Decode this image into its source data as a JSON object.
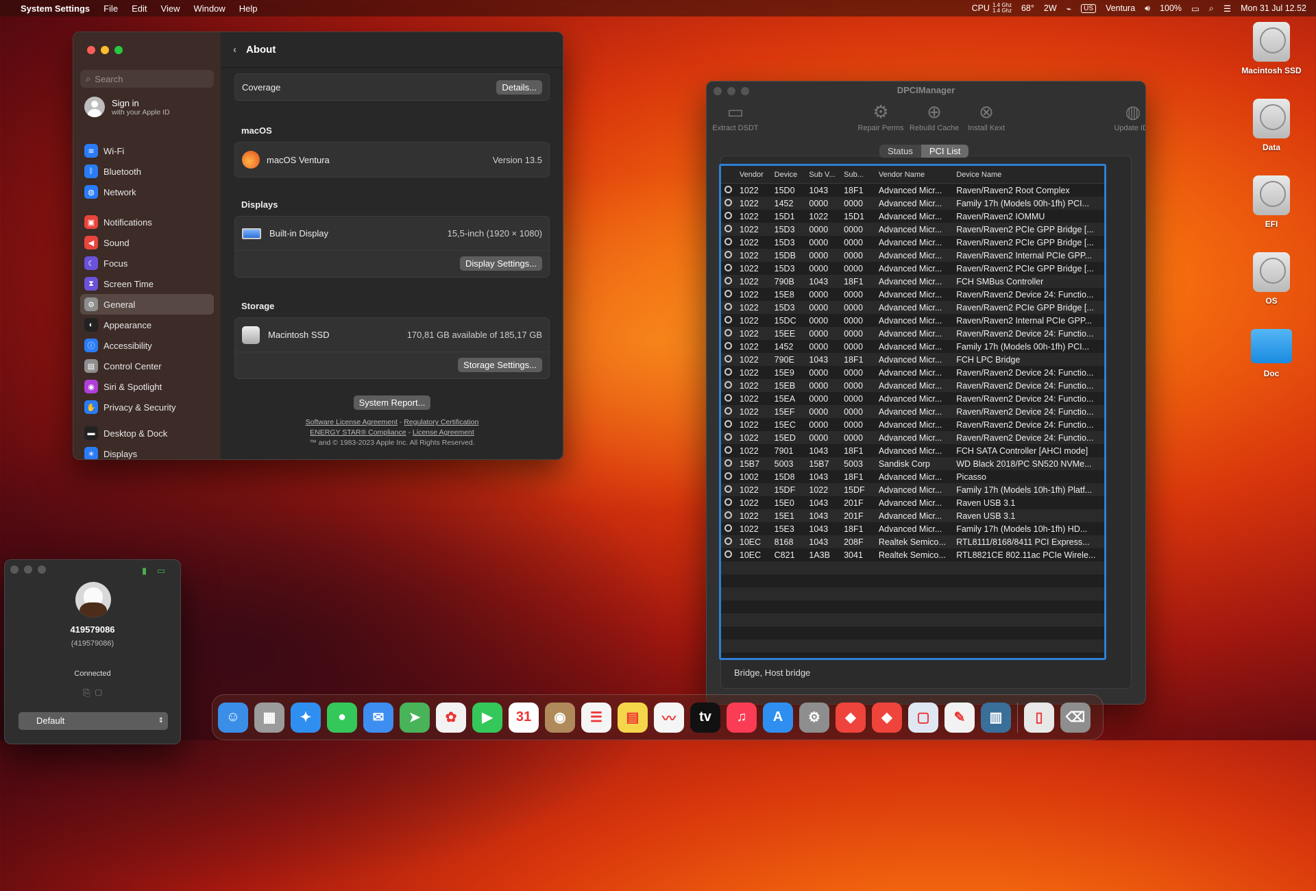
{
  "menubar": {
    "app": "System Settings",
    "menus": [
      "File",
      "Edit",
      "View",
      "Window",
      "Help"
    ],
    "cpu_label": "CPU",
    "cpu_f1": "1.4 Ghz",
    "cpu_f2": "1.4 Ghz",
    "temp": "68°",
    "power": "2W",
    "lang": "US",
    "os_name": "Ventura",
    "battery": "100%",
    "datetime": "Mon 31 Jul  12.52"
  },
  "settings": {
    "search_placeholder": "Search",
    "signin_title": "Sign in",
    "signin_sub": "with your Apple ID",
    "groups": [
      [
        {
          "label": "Wi-Fi",
          "icon": "wifi-icon",
          "color": "#2a7cf6",
          "glyph": "≋"
        },
        {
          "label": "Bluetooth",
          "icon": "bluetooth-icon",
          "color": "#2a7cf6",
          "glyph": "ᛒ"
        },
        {
          "label": "Network",
          "icon": "network-icon",
          "color": "#2a7cf6",
          "glyph": "◍"
        }
      ],
      [
        {
          "label": "Notifications",
          "icon": "notifications-icon",
          "color": "#e8453c",
          "glyph": "▣"
        },
        {
          "label": "Sound",
          "icon": "sound-icon",
          "color": "#e8453c",
          "glyph": "◀"
        },
        {
          "label": "Focus",
          "icon": "focus-icon",
          "color": "#6a52d9",
          "glyph": "☾"
        },
        {
          "label": "Screen Time",
          "icon": "screen-time-icon",
          "color": "#6a52d9",
          "glyph": "⧗"
        }
      ],
      [
        {
          "label": "General",
          "icon": "general-icon",
          "color": "#8e8e8e",
          "glyph": "⚙"
        },
        {
          "label": "Appearance",
          "icon": "appearance-icon",
          "color": "#222",
          "glyph": "◐"
        },
        {
          "label": "Accessibility",
          "icon": "accessibility-icon",
          "color": "#2a7cf6",
          "glyph": "ⓘ"
        },
        {
          "label": "Control Center",
          "icon": "control-center-icon",
          "color": "#8e8e8e",
          "glyph": "▤"
        },
        {
          "label": "Siri & Spotlight",
          "icon": "siri-icon",
          "color": "#b03fd9",
          "glyph": "◉"
        },
        {
          "label": "Privacy & Security",
          "icon": "privacy-icon",
          "color": "#2a7cf6",
          "glyph": "✋"
        }
      ],
      [
        {
          "label": "Desktop & Dock",
          "icon": "desktop-dock-icon",
          "color": "#222",
          "glyph": "▬"
        },
        {
          "label": "Displays",
          "icon": "displays-icon",
          "color": "#2a7cf6",
          "glyph": "☀"
        }
      ]
    ],
    "selected": "General",
    "page_title": "About",
    "coverage_label": "Coverage",
    "details_btn": "Details...",
    "macos_head": "macOS",
    "macos_name": "macOS Ventura",
    "macos_version": "Version 13.5",
    "displays_head": "Displays",
    "display_name": "Built-in Display",
    "display_val": "15,5-inch (1920 × 1080)",
    "display_btn": "Display Settings...",
    "storage_head": "Storage",
    "storage_name": "Macintosh SSD",
    "storage_val": "170,81 GB available of 185,17 GB",
    "storage_btn": "Storage Settings...",
    "report_btn": "System Report...",
    "link1": "Software License Agreement",
    "link2": "Regulatory Certification",
    "link3": "ENERGY STAR® Compliance",
    "link4": "License Agreement",
    "sep": "-",
    "copyright": "™ and © 1983-2023 Apple Inc. All Rights Reserved."
  },
  "dpci": {
    "title": "DPCIManager",
    "tools": [
      {
        "label": "Extract DSDT",
        "icon": "extract-dsdt-icon",
        "glyph": "▭"
      },
      {
        "label": "Repair Perms",
        "icon": "repair-perms-icon",
        "glyph": "⚙"
      },
      {
        "label": "Rebuild Cache",
        "icon": "rebuild-cache-icon",
        "glyph": "⊕"
      },
      {
        "label": "Install Kext",
        "icon": "install-kext-icon",
        "glyph": "⊗"
      },
      {
        "label": "Update IDs",
        "icon": "update-ids-icon",
        "glyph": "◍"
      }
    ],
    "tabs": [
      "Status",
      "PCI List"
    ],
    "active_tab": "PCI List",
    "columns": [
      "Vendor",
      "Device",
      "Sub V...",
      "Sub...",
      "Vendor Name",
      "Device Name"
    ],
    "rows": [
      [
        "1022",
        "15D0",
        "1043",
        "18F1",
        "Advanced Micr...",
        "Raven/Raven2 Root Complex"
      ],
      [
        "1022",
        "1452",
        "0000",
        "0000",
        "Advanced Micr...",
        "Family 17h (Models 00h-1fh) PCI..."
      ],
      [
        "1022",
        "15D1",
        "1022",
        "15D1",
        "Advanced Micr...",
        "Raven/Raven2 IOMMU"
      ],
      [
        "1022",
        "15D3",
        "0000",
        "0000",
        "Advanced Micr...",
        "Raven/Raven2 PCIe GPP Bridge [..."
      ],
      [
        "1022",
        "15D3",
        "0000",
        "0000",
        "Advanced Micr...",
        "Raven/Raven2 PCIe GPP Bridge [..."
      ],
      [
        "1022",
        "15DB",
        "0000",
        "0000",
        "Advanced Micr...",
        "Raven/Raven2 Internal PCIe GPP..."
      ],
      [
        "1022",
        "15D3",
        "0000",
        "0000",
        "Advanced Micr...",
        "Raven/Raven2 PCIe GPP Bridge [..."
      ],
      [
        "1022",
        "790B",
        "1043",
        "18F1",
        "Advanced Micr...",
        "FCH SMBus Controller"
      ],
      [
        "1022",
        "15E8",
        "0000",
        "0000",
        "Advanced Micr...",
        "Raven/Raven2 Device 24: Functio..."
      ],
      [
        "1022",
        "15D3",
        "0000",
        "0000",
        "Advanced Micr...",
        "Raven/Raven2 PCIe GPP Bridge [..."
      ],
      [
        "1022",
        "15DC",
        "0000",
        "0000",
        "Advanced Micr...",
        "Raven/Raven2 Internal PCIe GPP..."
      ],
      [
        "1022",
        "15EE",
        "0000",
        "0000",
        "Advanced Micr...",
        "Raven/Raven2 Device 24: Functio..."
      ],
      [
        "1022",
        "1452",
        "0000",
        "0000",
        "Advanced Micr...",
        "Family 17h (Models 00h-1fh) PCI..."
      ],
      [
        "1022",
        "790E",
        "1043",
        "18F1",
        "Advanced Micr...",
        "FCH LPC Bridge"
      ],
      [
        "1022",
        "15E9",
        "0000",
        "0000",
        "Advanced Micr...",
        "Raven/Raven2 Device 24: Functio..."
      ],
      [
        "1022",
        "15EB",
        "0000",
        "0000",
        "Advanced Micr...",
        "Raven/Raven2 Device 24: Functio..."
      ],
      [
        "1022",
        "15EA",
        "0000",
        "0000",
        "Advanced Micr...",
        "Raven/Raven2 Device 24: Functio..."
      ],
      [
        "1022",
        "15EF",
        "0000",
        "0000",
        "Advanced Micr...",
        "Raven/Raven2 Device 24: Functio..."
      ],
      [
        "1022",
        "15EC",
        "0000",
        "0000",
        "Advanced Micr...",
        "Raven/Raven2 Device 24: Functio..."
      ],
      [
        "1022",
        "15ED",
        "0000",
        "0000",
        "Advanced Micr...",
        "Raven/Raven2 Device 24: Functio..."
      ],
      [
        "1022",
        "7901",
        "1043",
        "18F1",
        "Advanced Micr...",
        "FCH SATA Controller [AHCI mode]"
      ],
      [
        "15B7",
        "5003",
        "15B7",
        "5003",
        "Sandisk Corp",
        "WD Black 2018/PC SN520 NVMe..."
      ],
      [
        "1002",
        "15D8",
        "1043",
        "18F1",
        "Advanced Micr...",
        "Picasso"
      ],
      [
        "1022",
        "15DF",
        "1022",
        "15DF",
        "Advanced Micr...",
        "Family 17h (Models 10h-1fh) Platf..."
      ],
      [
        "1022",
        "15E0",
        "1043",
        "201F",
        "Advanced Micr...",
        "Raven USB 3.1"
      ],
      [
        "1022",
        "15E1",
        "1043",
        "201F",
        "Advanced Micr...",
        "Raven USB 3.1"
      ],
      [
        "1022",
        "15E3",
        "1043",
        "18F1",
        "Advanced Micr...",
        "Family 17h (Models 10h-1fh) HD..."
      ],
      [
        "10EC",
        "8168",
        "1043",
        "208F",
        "Realtek Semico...",
        "RTL8111/8168/8411 PCI Express..."
      ],
      [
        "10EC",
        "C821",
        "1A3B",
        "3041",
        "Realtek Semico...",
        "RTL8821CE 802.11ac PCIe Wirele..."
      ]
    ],
    "empty_rows": 7,
    "status": "Bridge, Host bridge"
  },
  "remote": {
    "id": "419579086",
    "id_paren": "(419579086)",
    "state": "Connected",
    "profile": "Default"
  },
  "desktop": [
    {
      "label": "Macintosh SSD",
      "type": "disk"
    },
    {
      "label": "Data",
      "type": "disk"
    },
    {
      "label": "EFI",
      "type": "disk"
    },
    {
      "label": "OS",
      "type": "disk"
    },
    {
      "label": "Doc",
      "type": "folder"
    }
  ],
  "dock": [
    {
      "name": "finder",
      "color": "#3a8ee8",
      "glyph": "☺"
    },
    {
      "name": "launchpad",
      "color": "#9b9b9b",
      "glyph": "▦"
    },
    {
      "name": "safari",
      "color": "#2f8ff0",
      "glyph": "✦"
    },
    {
      "name": "messages",
      "color": "#34c759",
      "glyph": "●"
    },
    {
      "name": "mail",
      "color": "#3d8ef0",
      "glyph": "✉"
    },
    {
      "name": "maps",
      "color": "#49b35a",
      "glyph": "➤"
    },
    {
      "name": "photos",
      "color": "#f2f2f2",
      "glyph": "✿"
    },
    {
      "name": "facetime",
      "color": "#34c759",
      "glyph": "▶"
    },
    {
      "name": "calendar",
      "color": "#ffffff",
      "glyph": "31"
    },
    {
      "name": "contacts",
      "color": "#b08a5a",
      "glyph": "◉"
    },
    {
      "name": "reminders",
      "color": "#f5f5f5",
      "glyph": "☰"
    },
    {
      "name": "notes",
      "color": "#f5d64a",
      "glyph": "▤"
    },
    {
      "name": "freeform",
      "color": "#f5f5f5",
      "glyph": "〰"
    },
    {
      "name": "apple-tv",
      "color": "#111111",
      "glyph": "tv"
    },
    {
      "name": "music",
      "color": "#fa3c55",
      "glyph": "♫"
    },
    {
      "name": "app-store",
      "color": "#2f8ff0",
      "glyph": "A"
    },
    {
      "name": "system-settings",
      "color": "#8e8e8e",
      "glyph": "⚙"
    },
    {
      "name": "anydesk",
      "color": "#ef443b",
      "glyph": "◆"
    },
    {
      "name": "anydesk-2",
      "color": "#ef443b",
      "glyph": "◆"
    },
    {
      "name": "preview",
      "color": "#dfe8f2",
      "glyph": "▢"
    },
    {
      "name": "textedit",
      "color": "#f2f2f2",
      "glyph": "✎"
    },
    {
      "name": "system-info",
      "color": "#3a6f9a",
      "glyph": "▥"
    },
    {
      "name": "document",
      "color": "#e8e8e8",
      "glyph": "▯"
    },
    {
      "name": "trash",
      "color": "#8e8e8e",
      "glyph": "⌫"
    }
  ]
}
